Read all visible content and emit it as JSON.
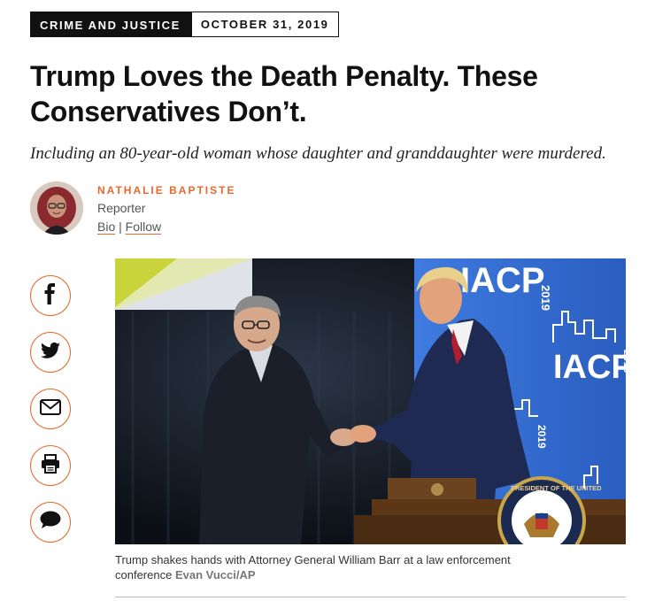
{
  "article": {
    "section": "CRIME AND JUSTICE",
    "date": "OCTOBER 31, 2019",
    "headline": "Trump Loves the Death Penalty. These Conservatives Don’t.",
    "dek": "Including an 80-year-old woman whose daughter and granddaughter were murdered."
  },
  "author": {
    "name": "NATHALIE BAPTISTE",
    "role": "Reporter",
    "bio_link": "Bio",
    "separator": "|",
    "follow_link": "Follow"
  },
  "share": [
    {
      "name": "facebook-icon"
    },
    {
      "name": "twitter-icon"
    },
    {
      "name": "email-icon"
    },
    {
      "name": "print-icon"
    },
    {
      "name": "comment-icon"
    }
  ],
  "photo": {
    "sign_text_top": "IACP",
    "sign_year_top": "2019",
    "sign_text_mid": "IACP",
    "sign_year_mid": "2019",
    "sign_year_bottom": "2019",
    "seal_text": "PRESIDENT OF THE UNITED",
    "caption": "Trump shakes hands with Attorney General William Barr at a law enforcement conference",
    "credit": "Evan Vucci/AP"
  },
  "colors": {
    "accent": "#e8682b",
    "banner_blue": "#2a63c7"
  }
}
